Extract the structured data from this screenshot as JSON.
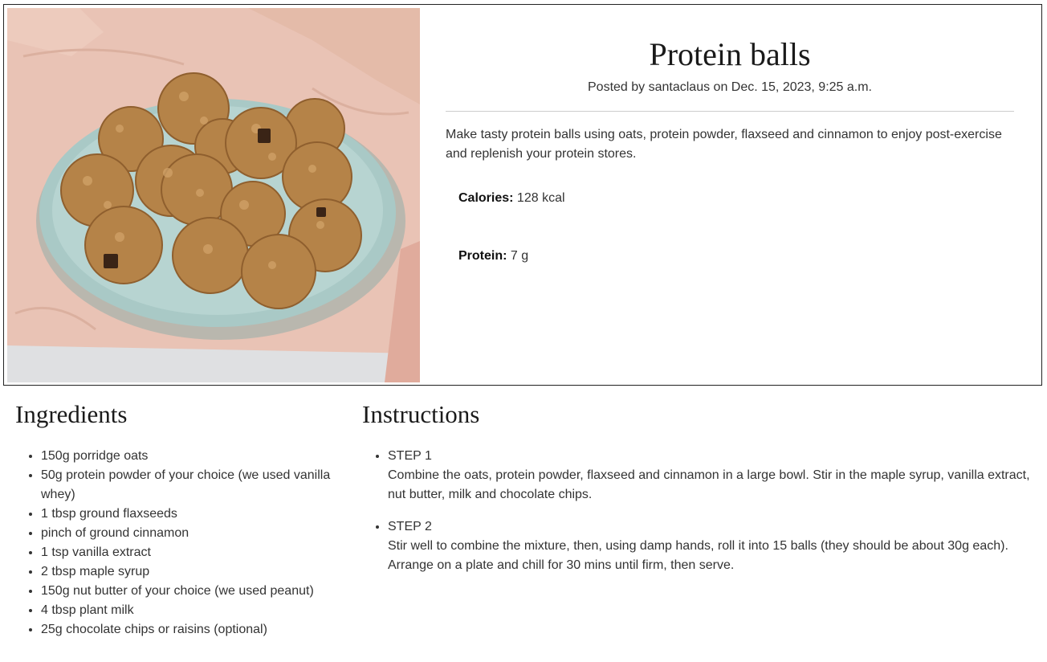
{
  "recipe": {
    "title": "Protein balls",
    "byline": "Posted by santaclaus on Dec. 15, 2023, 9:25 a.m.",
    "description": "Make tasty protein balls using oats, protein powder, flaxseed and cinnamon to enjoy post-exercise and replenish your protein stores.",
    "nutrition": {
      "calories_label": "Calories:",
      "calories_value": "128 kcal",
      "protein_label": "Protein:",
      "protein_value": "7 g"
    }
  },
  "ingredients": {
    "heading": "Ingredients",
    "items": [
      "150g porridge oats",
      "50g protein powder of your choice (we used vanilla whey)",
      "1 tbsp ground flaxseeds",
      "pinch of ground cinnamon",
      "1 tsp vanilla extract",
      "2 tbsp maple syrup",
      "150g nut butter of your choice (we used peanut)",
      "4 tbsp plant milk",
      "25g chocolate chips or raisins (optional)"
    ]
  },
  "instructions": {
    "heading": "Instructions",
    "steps": [
      {
        "label": "STEP 1",
        "text": "Combine the oats, protein powder, flaxseed and cinnamon in a large bowl. Stir in the maple syrup, vanilla extract, nut butter, milk and chocolate chips."
      },
      {
        "label": "STEP 2",
        "text": "Stir well to combine the mixture, then, using damp hands, roll it into 15 balls (they should be about 30g each). Arrange on a plate and chill for 30 mins until firm, then serve."
      }
    ]
  }
}
